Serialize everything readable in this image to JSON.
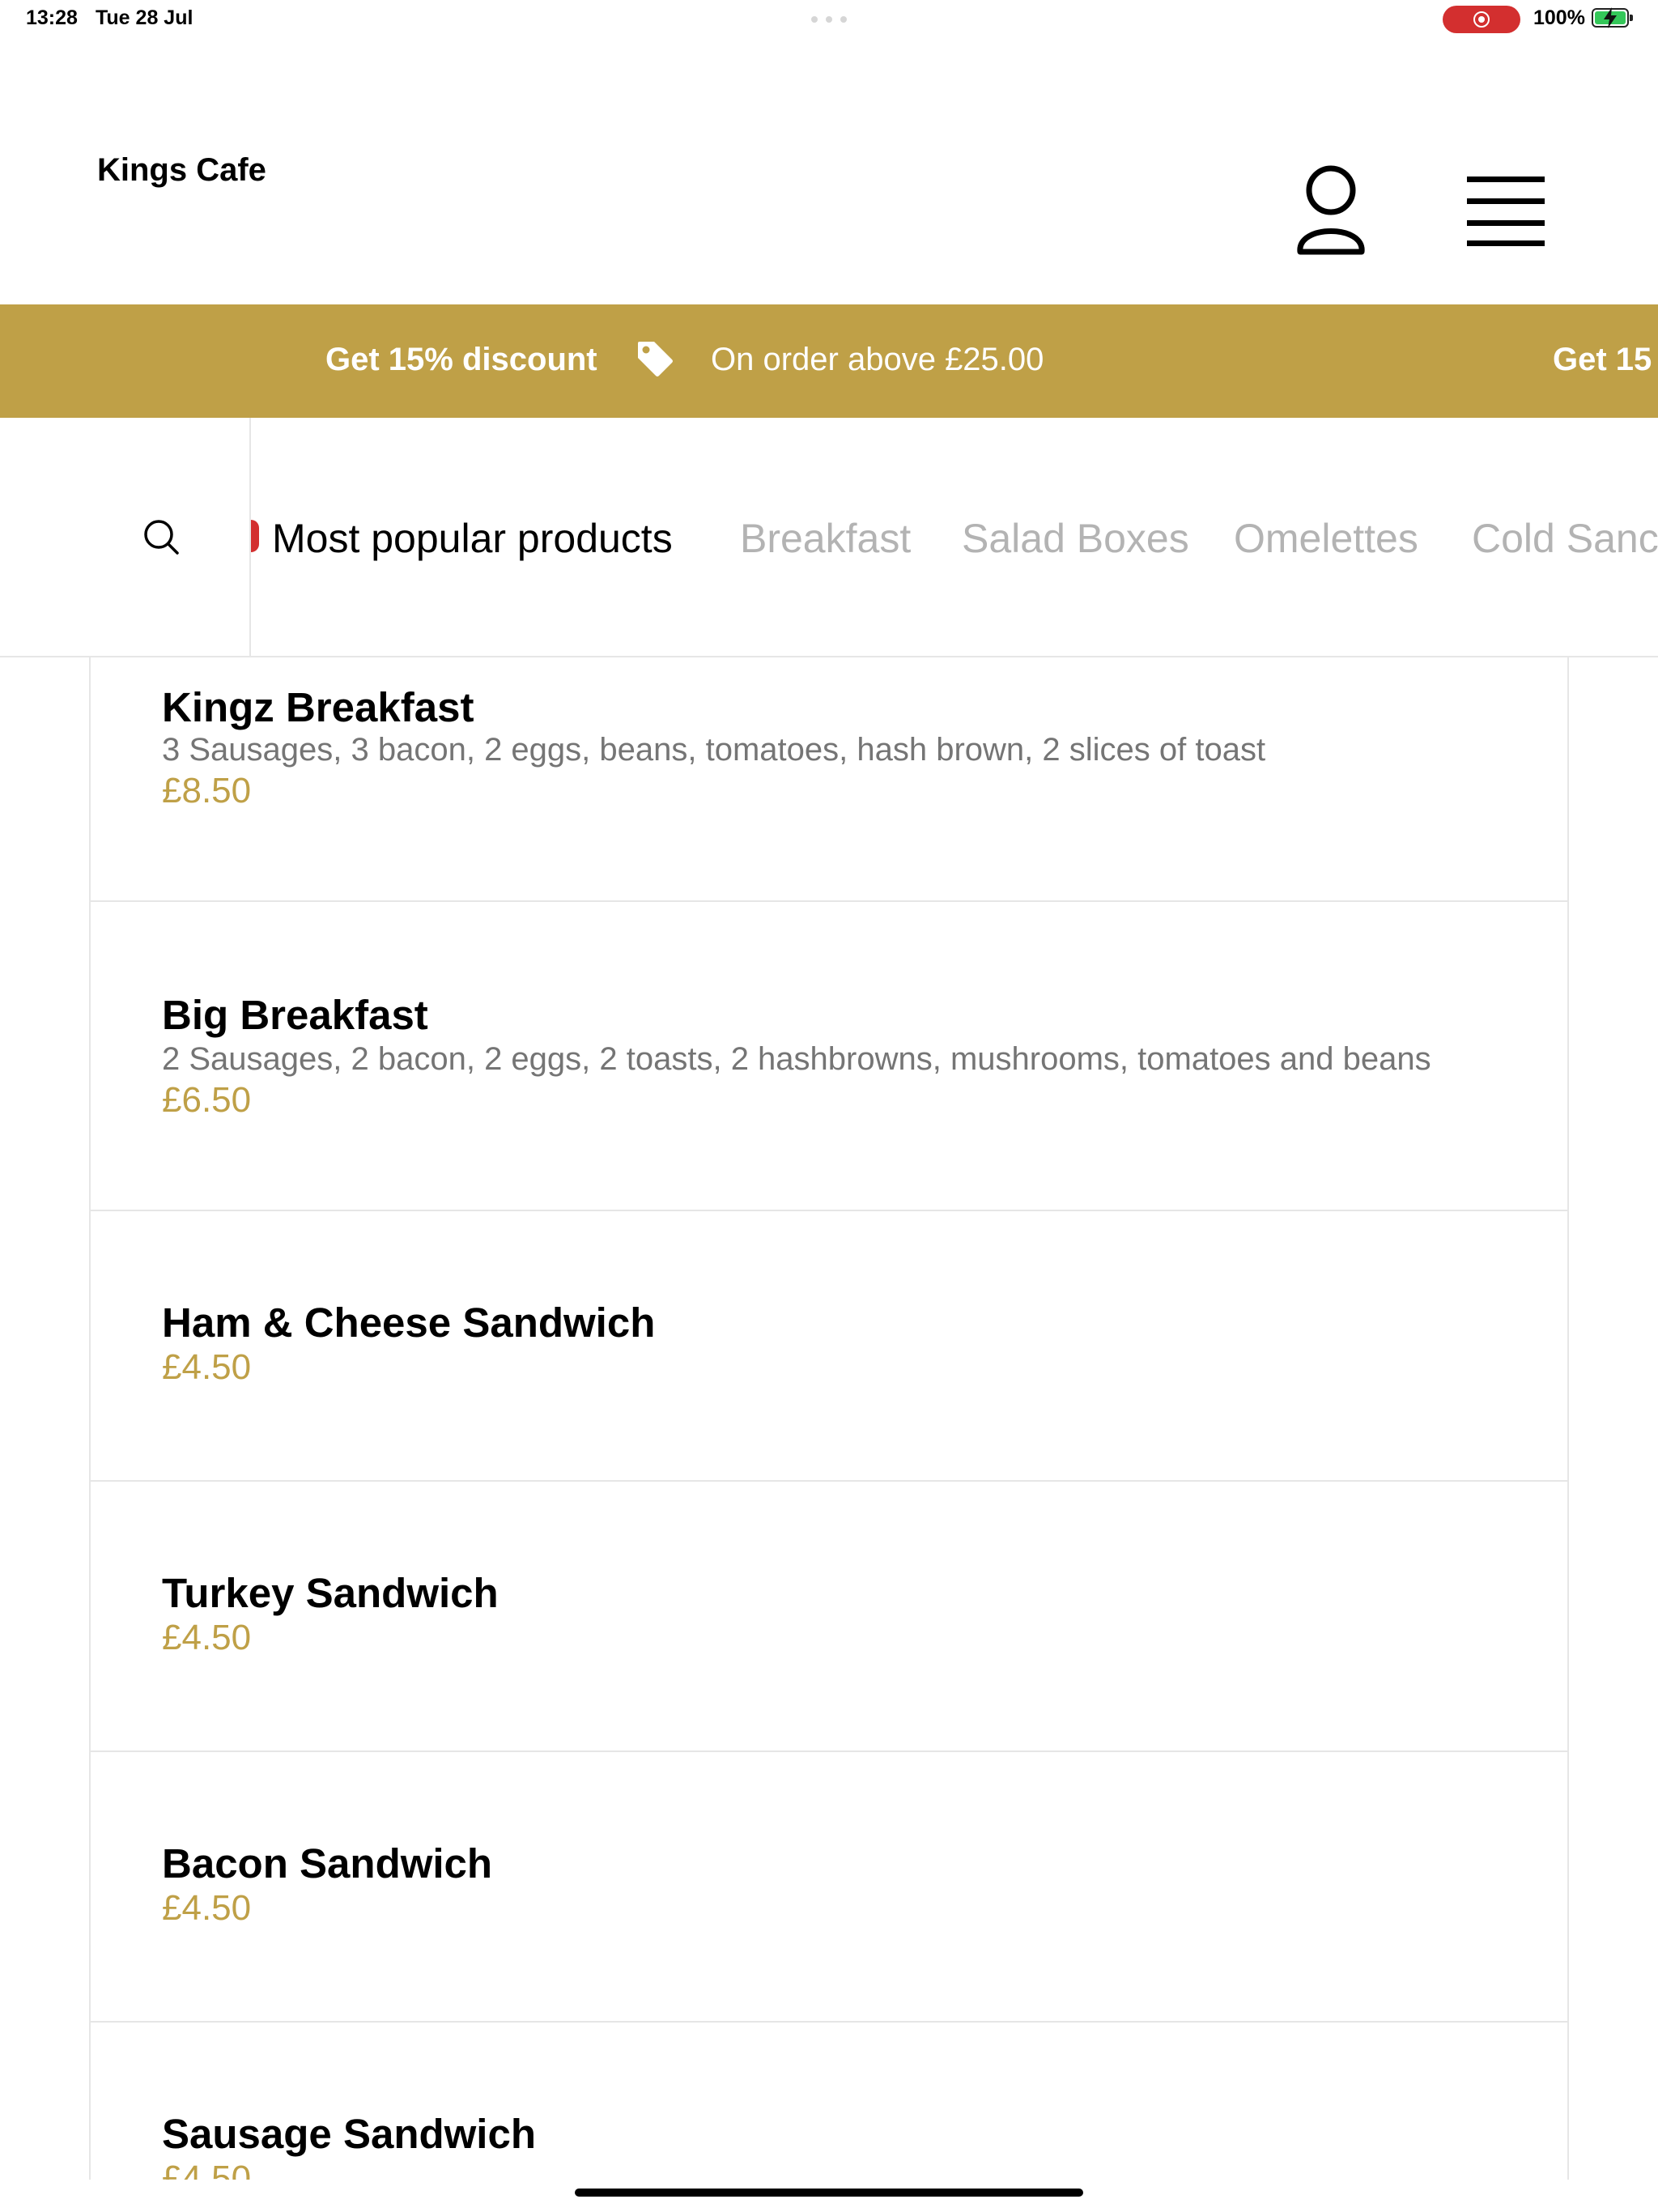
{
  "status_bar": {
    "time": "13:28",
    "date": "Tue 28 Jul",
    "battery": "100%"
  },
  "header": {
    "brand": "Kings Cafe",
    "icons": [
      "user-icon",
      "menu-icon"
    ]
  },
  "promo": {
    "title": "Get 15% discount",
    "subtitle": "On order above £25.00",
    "title_repeat": "Get 15",
    "background": "#bfa047",
    "icon": "tag-icon"
  },
  "categories": {
    "items": [
      {
        "label": "Most popular products",
        "active": true
      },
      {
        "label": "Breakfast",
        "active": false
      },
      {
        "label": "Salad Boxes",
        "active": false
      },
      {
        "label": "Omelettes",
        "active": false
      },
      {
        "label": "Cold Sanc",
        "active": false
      }
    ]
  },
  "products": [
    {
      "name": "Kingz Breakfast",
      "description": "3 Sausages, 3 bacon, 2 eggs, beans, tomatoes, hash brown, 2 slices of toast",
      "price": "£8.50"
    },
    {
      "name": "Big Breakfast",
      "description": "2 Sausages, 2 bacon, 2 eggs, 2 toasts, 2 hashbrowns, mushrooms, tomatoes and beans",
      "price": "£6.50"
    },
    {
      "name": "Ham & Cheese Sandwich",
      "price": "£4.50"
    },
    {
      "name": "Turkey Sandwich",
      "price": "£4.50"
    },
    {
      "name": "Bacon Sandwich",
      "price": "£4.50"
    },
    {
      "name": "Sausage Sandwich",
      "price": "£4.50"
    }
  ],
  "colors": {
    "accent": "#bfa047",
    "indicator": "#d32f2f",
    "inactive_tab": "#b3b3b3"
  }
}
